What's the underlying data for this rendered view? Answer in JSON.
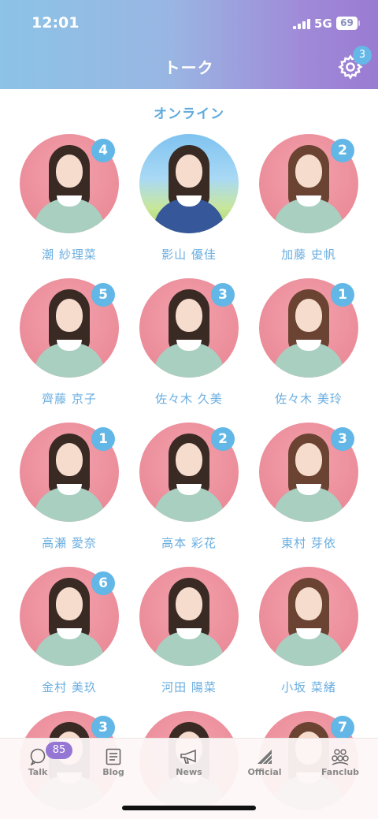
{
  "status_bar": {
    "time": "12:01",
    "network": "5G",
    "battery": "69"
  },
  "header": {
    "title": "トーク",
    "settings_badge": "3"
  },
  "section": {
    "title": "オンライン"
  },
  "members": [
    {
      "name": "潮 紗理菜",
      "badge": "4"
    },
    {
      "name": "影山 優佳",
      "badge": ""
    },
    {
      "name": "加藤 史帆",
      "badge": "2"
    },
    {
      "name": "齊藤 京子",
      "badge": "5"
    },
    {
      "name": "佐々木 久美",
      "badge": "3"
    },
    {
      "name": "佐々木 美玲",
      "badge": "1"
    },
    {
      "name": "高瀬 愛奈",
      "badge": "1"
    },
    {
      "name": "高本 彩花",
      "badge": "2"
    },
    {
      "name": "東村 芽依",
      "badge": "3"
    },
    {
      "name": "金村 美玖",
      "badge": "6"
    },
    {
      "name": "河田 陽菜",
      "badge": ""
    },
    {
      "name": "小坂 菜緒",
      "badge": ""
    },
    {
      "name": "",
      "badge": "3"
    },
    {
      "name": "",
      "badge": ""
    },
    {
      "name": "",
      "badge": "7"
    }
  ],
  "tabbar": {
    "talk": {
      "label": "Talk",
      "badge": "85",
      "icon": "chat-bubble-icon"
    },
    "blog": {
      "label": "Blog",
      "icon": "blog-document-icon"
    },
    "news": {
      "label": "News",
      "icon": "megaphone-icon"
    },
    "official": {
      "label": "Official",
      "icon": "official-logo-icon"
    },
    "fanclub": {
      "label": "Fanclub",
      "icon": "fanclub-people-icon"
    }
  },
  "colors": {
    "accent": "#62b7e6",
    "name_text": "#6aaee0",
    "talk_badge": "#9676d4",
    "avatar_bg": "#ec8f9c"
  }
}
